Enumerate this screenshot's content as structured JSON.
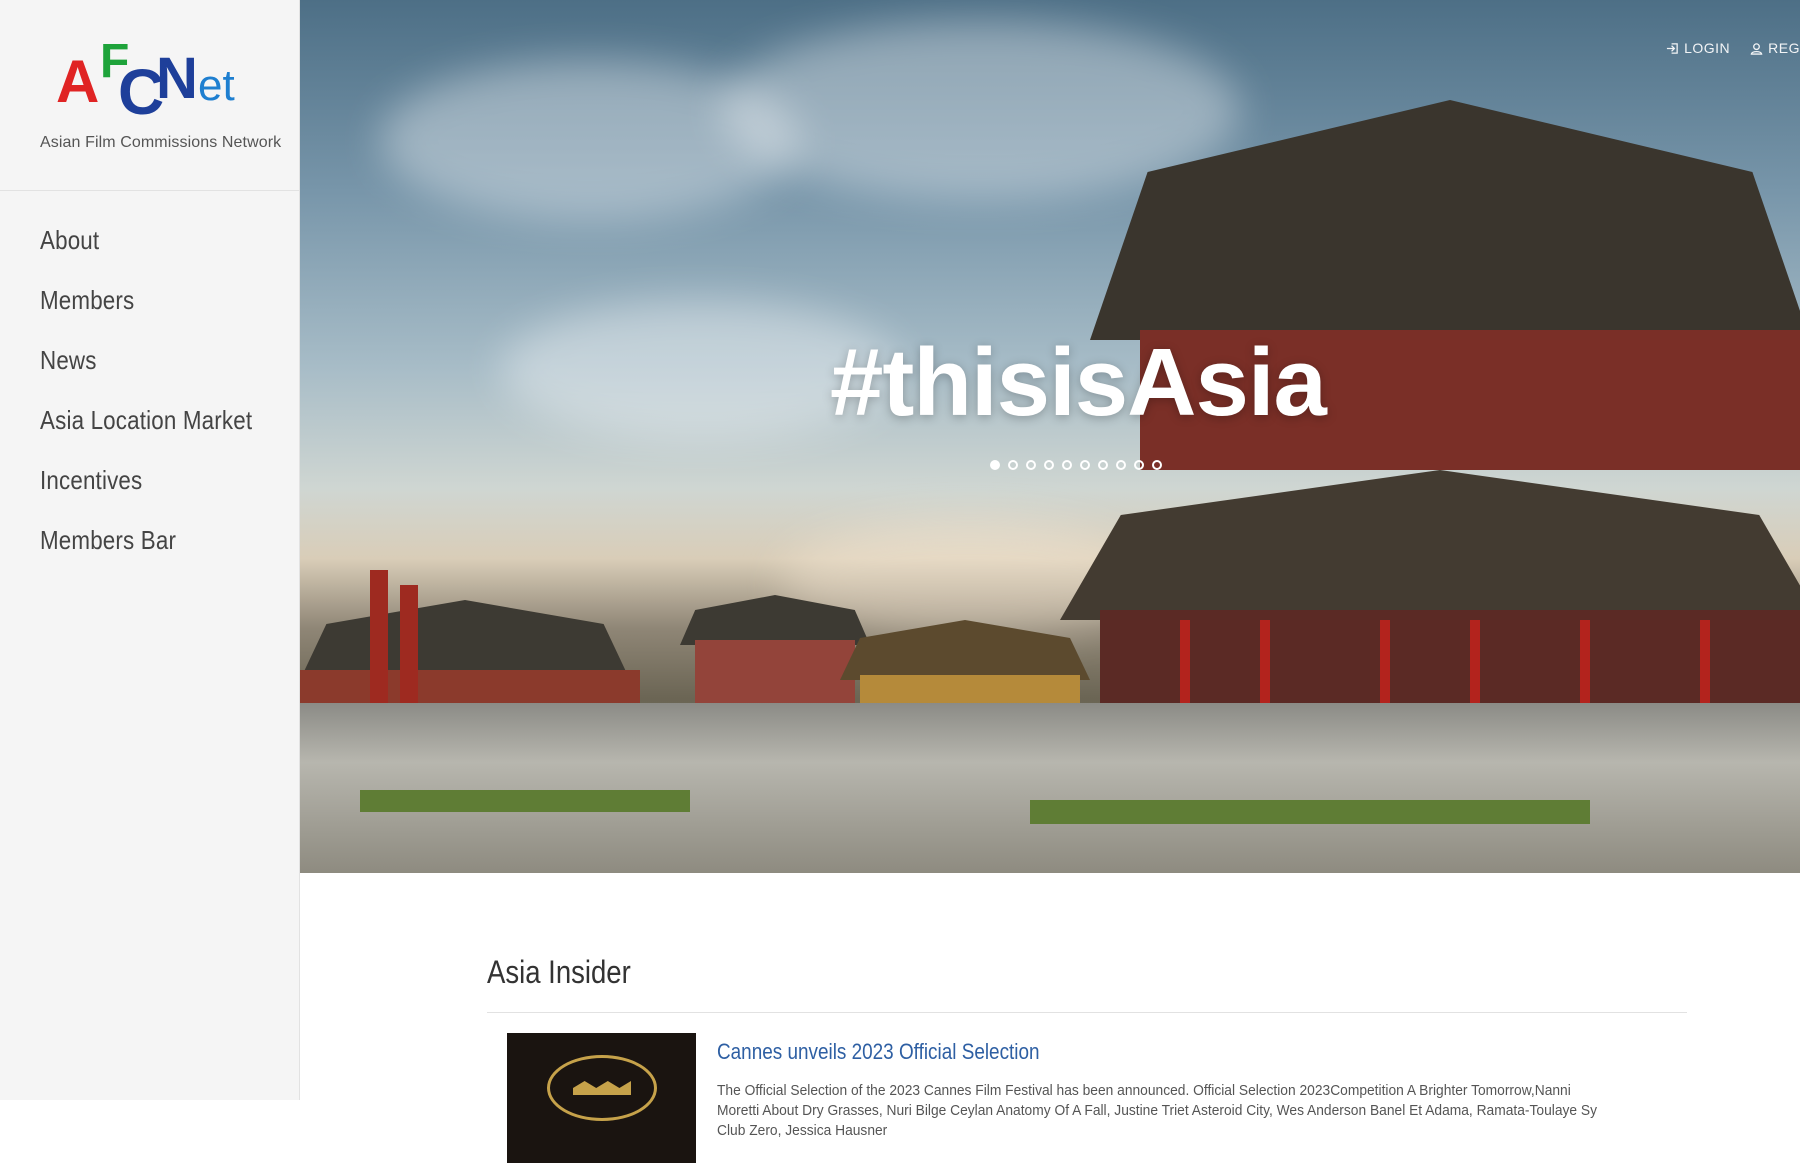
{
  "brand": {
    "logo_letters": [
      "A",
      "F",
      "C",
      "N",
      "et"
    ],
    "tagline": "Asian Film Commissions Network",
    "colors": {
      "red": "#e02424",
      "green": "#1ea33a",
      "blue": "#1e3f9a",
      "light_blue": "#1e7fd0"
    }
  },
  "nav": {
    "items": [
      {
        "label": "About"
      },
      {
        "label": "Members"
      },
      {
        "label": "News"
      },
      {
        "label": "Asia Location Market"
      },
      {
        "label": "Incentives"
      },
      {
        "label": "Members Bar"
      }
    ]
  },
  "header": {
    "login_label": "LOGIN",
    "register_label": "REG",
    "login_icon": "login-icon",
    "register_icon": "user-icon"
  },
  "hero": {
    "title": "#thisisAsia",
    "slide_count": 10,
    "active_slide": 1
  },
  "insider": {
    "title": "Asia Insider",
    "articles": [
      {
        "title": "Cannes unveils 2023 Official Selection",
        "excerpt": "The Official Selection of the 2023 Cannes Film Festival has been announced. Official Selection 2023Competition A Brighter Tomorrow,Nanni Moretti About Dry Grasses, Nuri Bilge Ceylan Anatomy Of A Fall, Justine Triet Asteroid City, Wes Anderson Banel Et Adama, Ramata-Toulaye Sy Club Zero, Jessica Hausner"
      }
    ]
  }
}
